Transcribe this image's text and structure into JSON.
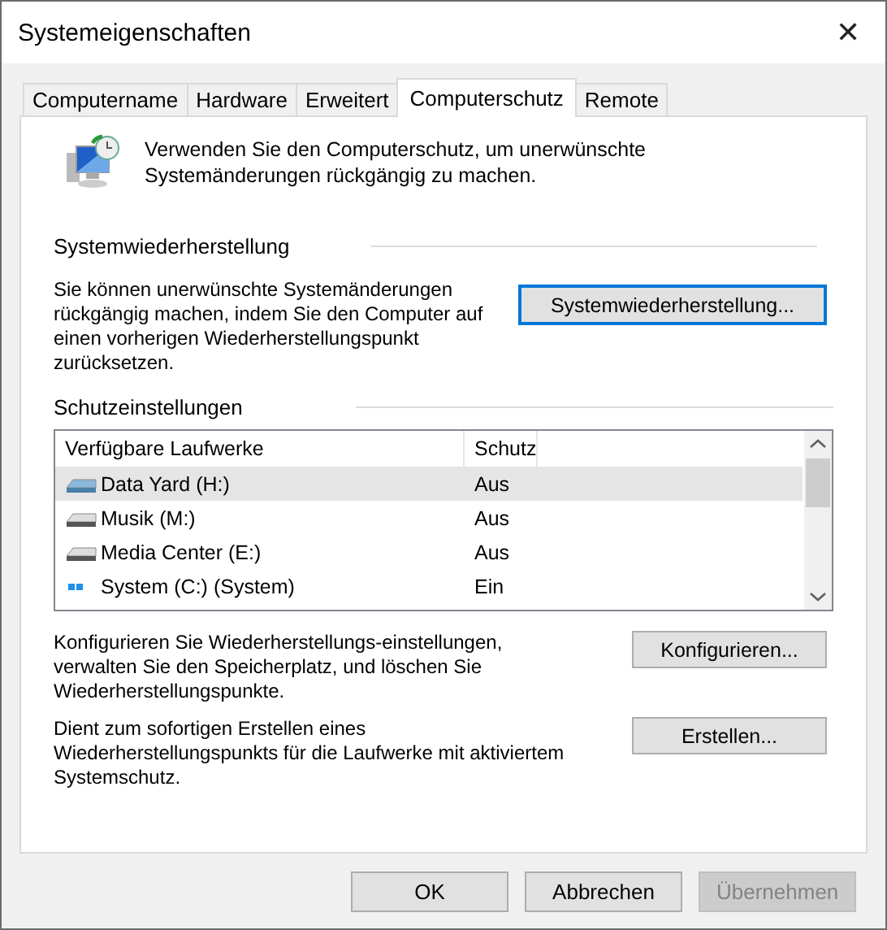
{
  "window": {
    "title": "Systemeigenschaften",
    "close": "✕"
  },
  "tabs": [
    {
      "label": "Computername",
      "selected": false
    },
    {
      "label": "Hardware",
      "selected": false
    },
    {
      "label": "Erweitert",
      "selected": false
    },
    {
      "label": "Computerschutz",
      "selected": true
    },
    {
      "label": "Remote",
      "selected": false
    }
  ],
  "intro": "Verwenden Sie den Computerschutz, um unerwünschte Systemänderungen rückgängig zu machen.",
  "restore": {
    "heading": "Systemwiederherstellung",
    "text": "Sie können unerwünschte Systemänderungen rückgängig machen, indem Sie den Computer auf einen vorherigen Wiederherstellungspunkt zurücksetzen.",
    "button": "Systemwiederherstellung..."
  },
  "protection": {
    "heading": "Schutzeinstellungen",
    "columns": [
      "Verfügbare Laufwerke",
      "Schutz"
    ],
    "rows": [
      {
        "kind": "drive",
        "name": "Data Yard (H:)",
        "status": "Aus",
        "selected": true
      },
      {
        "kind": "drive",
        "name": "Musik (M:)",
        "status": "Aus",
        "selected": false
      },
      {
        "kind": "drive",
        "name": "Media Center (E:)",
        "status": "Aus",
        "selected": false
      },
      {
        "kind": "system",
        "name": "System (C:) (System)",
        "status": "Ein",
        "selected": false
      }
    ],
    "configure_text": "Konfigurieren Sie Wiederherstellungs-einstellungen, verwalten Sie den Speicherplatz, und löschen Sie Wiederherstellungspunkte.",
    "configure_button": "Konfigurieren...",
    "create_text": "Dient zum sofortigen Erstellen eines Wiederherstellungspunkts für die Laufwerke mit aktiviertem Systemschutz.",
    "create_button": "Erstellen..."
  },
  "buttons": [
    {
      "label": "OK",
      "disabled": false
    },
    {
      "label": "Abbrechen",
      "disabled": false
    },
    {
      "label": "Übernehmen",
      "disabled": true
    }
  ]
}
